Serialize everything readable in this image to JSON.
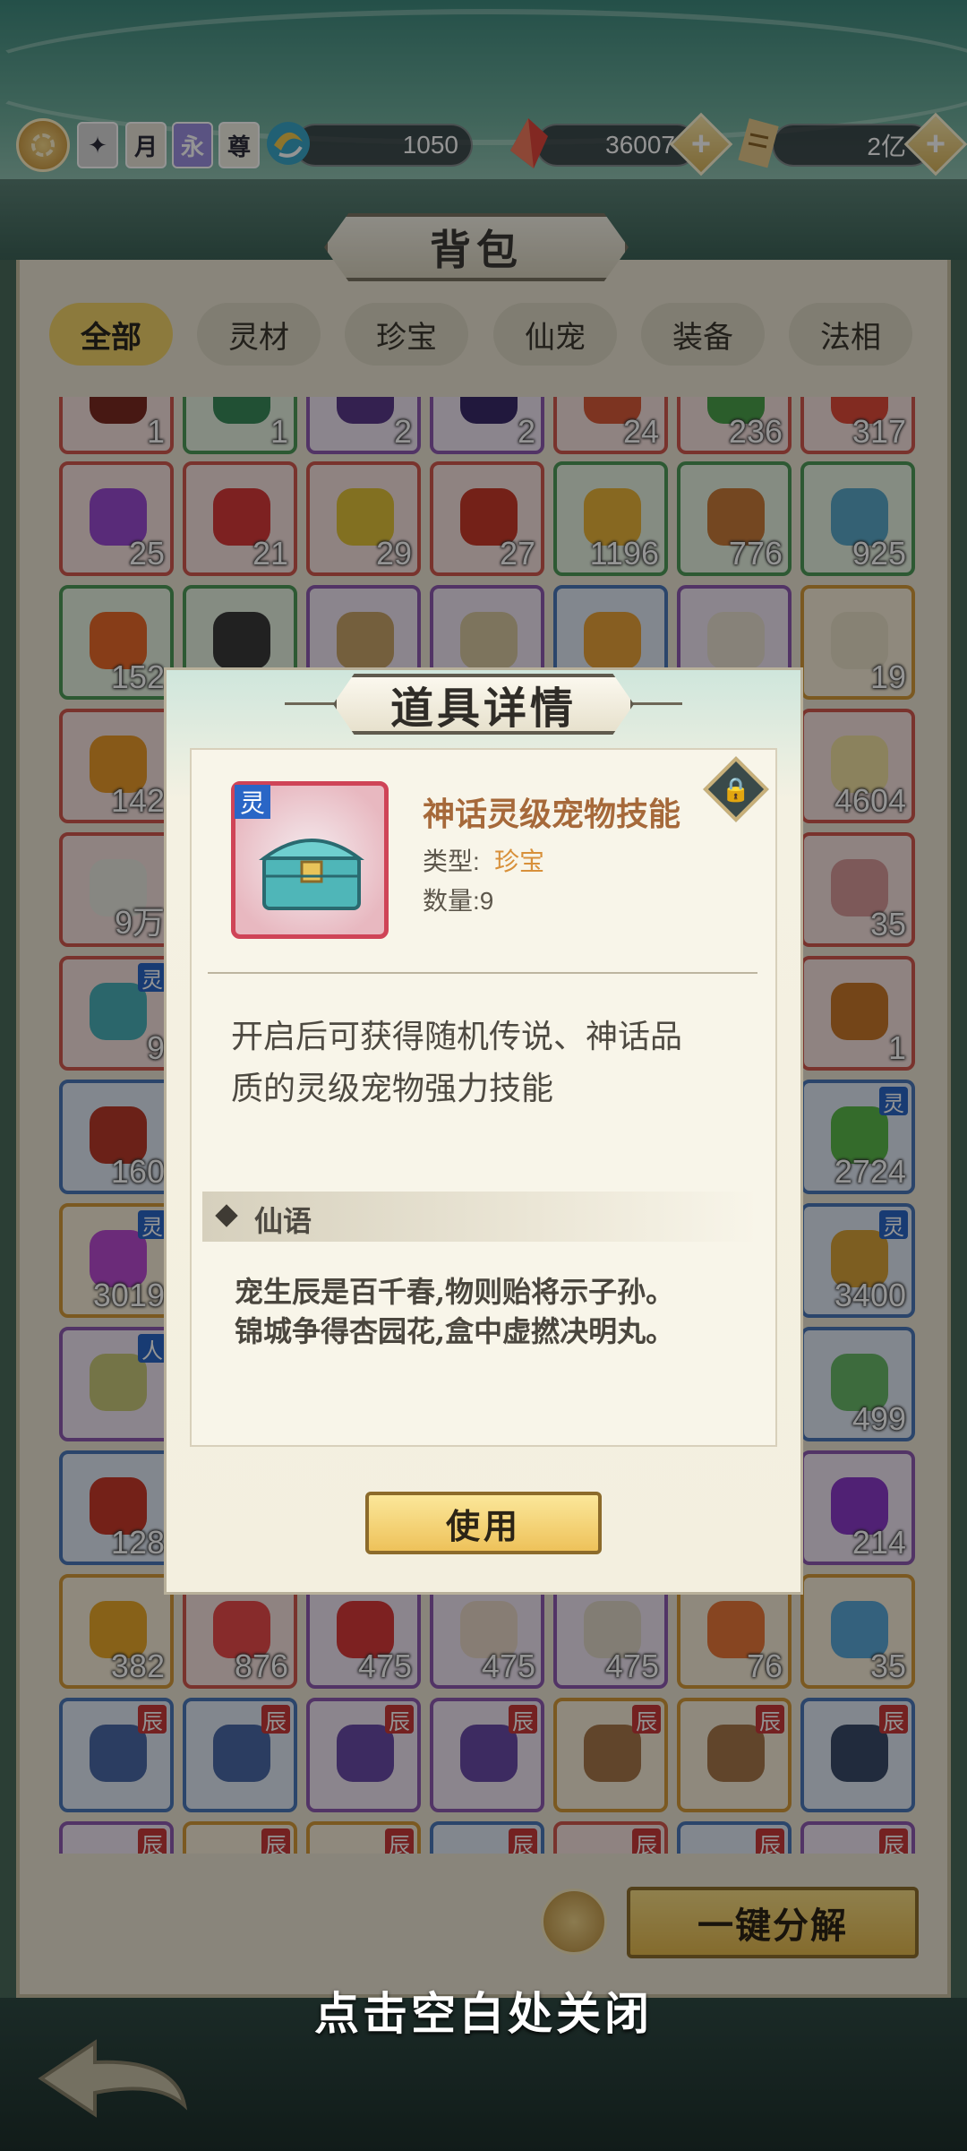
{
  "resources": {
    "jade_amount": "1050",
    "crystal_amount": "36007",
    "scroll_amount": "2亿",
    "badges": [
      "月",
      "永",
      "尊"
    ]
  },
  "bag": {
    "title": "背包",
    "tabs": [
      "全部",
      "灵材",
      "珍宝",
      "仙宠",
      "装备",
      "法相"
    ],
    "active_tab": "全部"
  },
  "grid_counts": {
    "row0": [
      "1",
      "1",
      "2",
      "2",
      "24",
      "236",
      "317"
    ],
    "row1": [
      "25",
      "21",
      "29",
      "27",
      "1196",
      "776",
      "925"
    ],
    "row2": [
      "152",
      "",
      "",
      "",
      "",
      "",
      "19"
    ],
    "row3": [
      "142",
      "",
      "",
      "",
      "",
      "",
      "4604"
    ],
    "row4": [
      "9万",
      "",
      "",
      "",
      "",
      "",
      "35"
    ],
    "row5": [
      "9",
      "",
      "",
      "",
      "",
      "",
      "1"
    ],
    "row6": [
      "160",
      "",
      "",
      "",
      "",
      "",
      "2724"
    ],
    "row7": [
      "3019",
      "",
      "",
      "",
      "",
      "",
      "3400"
    ],
    "row8": [
      "",
      "",
      "",
      "",
      "",
      "",
      "499"
    ],
    "row9": [
      "128",
      "",
      "",
      "",
      "",
      "",
      "214"
    ],
    "row10": [
      "382",
      "876",
      "475",
      "475",
      "475",
      "76",
      "35"
    ]
  },
  "grid_tags": {
    "ling": "灵",
    "ren": "人",
    "chen": "辰"
  },
  "modal": {
    "title": "道具详情",
    "item_tag": "灵",
    "item_name": "神话灵级宠物技能",
    "type_label": "类型:",
    "type_value": "珍宝",
    "quantity": "数量:9",
    "description": "开启后可获得随机传说、神话品质的灵级宠物强力技能",
    "lore_title": "仙语",
    "lore_line1": "宠生辰是百千春,物则贻将示子孙。",
    "lore_line2": "锦城争得杏园花,盒中虚撚决明丸。",
    "use_button": "使用"
  },
  "bottom": {
    "decompose_button": "一键分解",
    "close_hint": "点击空白处关闭"
  },
  "colors": {
    "accent_gold": "#f2d36a",
    "rarity_red": "#d0584f",
    "rarity_orange": "#d8903a"
  }
}
